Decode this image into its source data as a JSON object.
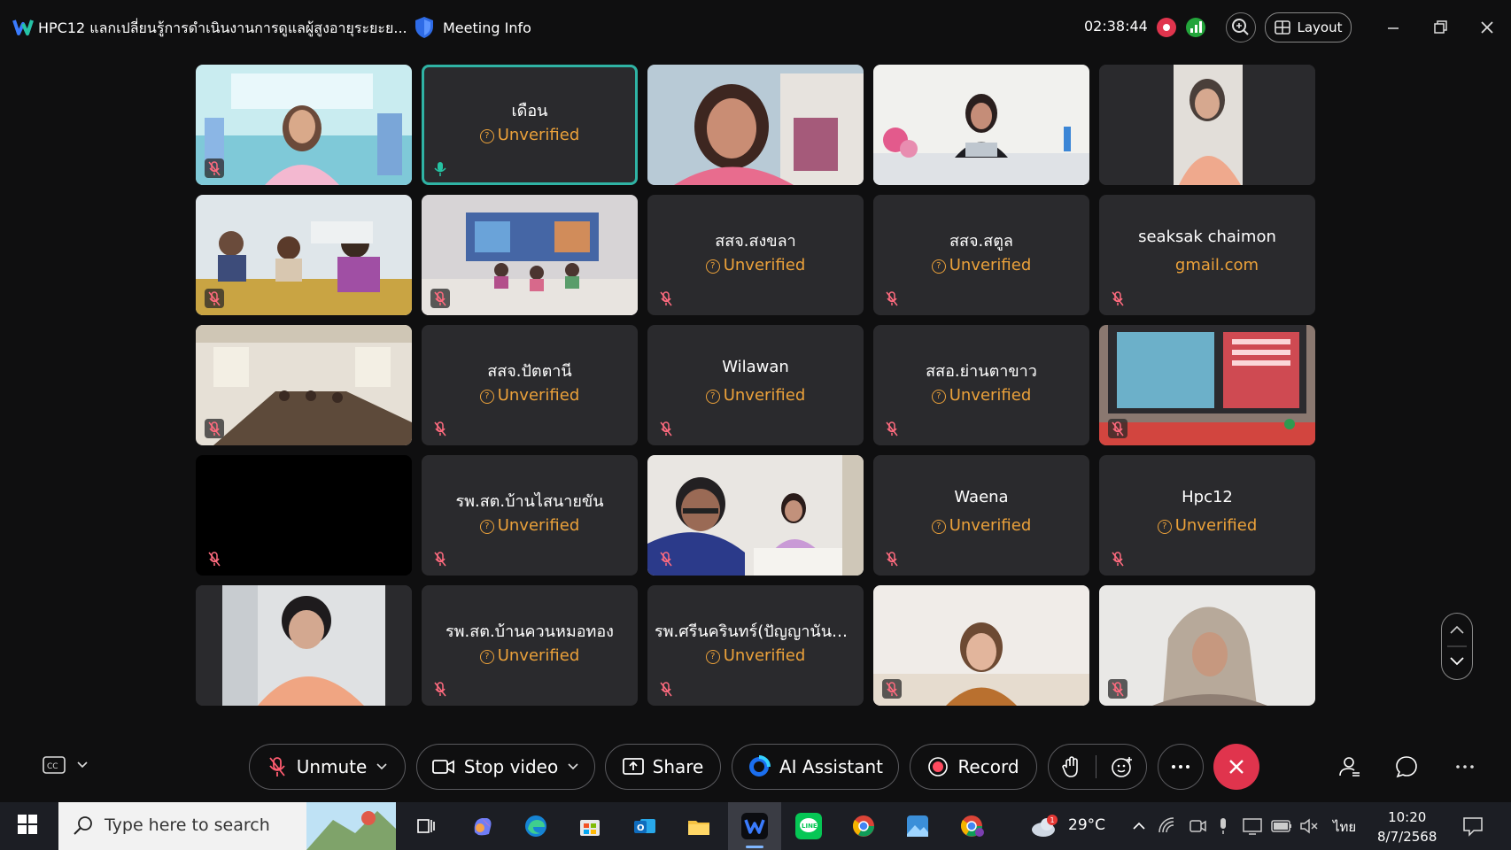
{
  "titlebar": {
    "app_title": "HPC12 แลกเปลี่ยนรู้การดำเนินงานการดูแลผู้สูงอายุระยะย...",
    "meeting_info": "Meeting Info",
    "timer": "02:38:44",
    "layout_label": "Layout"
  },
  "participants": {
    "r1c2": {
      "name": "เดือน",
      "status": "Unverified"
    },
    "r2c3": {
      "name": "สสจ.สงขลา",
      "status": "Unverified"
    },
    "r2c4": {
      "name": "สสจ.สตูล",
      "status": "Unverified"
    },
    "r2c5": {
      "name": "seaksak chaimon",
      "status": "gmail.com"
    },
    "r3c2": {
      "name": "สสจ.ปัตตานี",
      "status": "Unverified"
    },
    "r3c3": {
      "name": "Wilawan",
      "status": "Unverified"
    },
    "r3c4": {
      "name": "สสอ.ย่านตาขาว",
      "status": "Unverified"
    },
    "r4c2": {
      "name": "รพ.สต.บ้านไสนายขัน",
      "status": "Unverified"
    },
    "r4c4": {
      "name": "Waena",
      "status": "Unverified"
    },
    "r4c5": {
      "name": "Hpc12",
      "status": "Unverified"
    },
    "r5c2": {
      "name": "รพ.สต.บ้านควนหมอทอง",
      "status": "Unverified"
    },
    "r5c3": {
      "name": "รพ.ศรีนครินทร์(ปัญญานันท...",
      "status": "Unverified"
    }
  },
  "toolbar": {
    "unmute": "Unmute",
    "stop_video": "Stop video",
    "share": "Share",
    "ai_assistant": "AI Assistant",
    "record": "Record"
  },
  "taskbar": {
    "search_placeholder": "Type here to search",
    "weather_temp": "29°C",
    "weather_badge": "1",
    "language": "ไทย",
    "time": "10:20",
    "date": "8/7/2568"
  },
  "colors": {
    "background": "#0f0f10",
    "tile": "#2a2a2d",
    "unverified": "#eba13a",
    "active_border": "#2fb3a4",
    "end_call": "#e0344d"
  }
}
